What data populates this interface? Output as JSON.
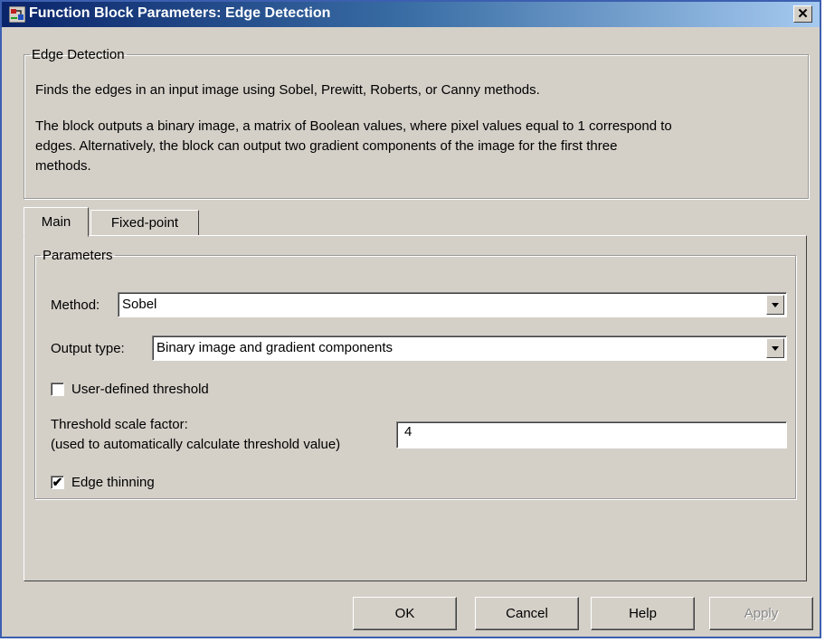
{
  "window": {
    "title": "Function Block Parameters: Edge Detection",
    "close_label": "✕"
  },
  "description": {
    "group_label": "Edge Detection",
    "line1": "Finds the edges in an input image using Sobel, Prewitt, Roberts, or Canny methods.",
    "line2": "The block outputs a binary image, a matrix of Boolean values, where pixel values equal to 1 correspond to",
    "line3": "edges.  Alternatively, the block can output two gradient components of the image for the first three",
    "line4": "methods."
  },
  "tabs": [
    {
      "label": "Main",
      "active": true
    },
    {
      "label": "Fixed-point",
      "active": false
    }
  ],
  "parameters": {
    "group_label": "Parameters",
    "method_label": "Method:",
    "method_value": "Sobel",
    "output_type_label": "Output type:",
    "output_type_value": "Binary image and gradient components",
    "user_threshold_label": "User-defined threshold",
    "user_threshold_checked": false,
    "threshold_scale_label_line1": "Threshold scale factor:",
    "threshold_scale_label_line2": "(used to automatically calculate threshold value)",
    "threshold_scale_value": "4",
    "edge_thinning_label": "Edge thinning",
    "edge_thinning_checked": true,
    "edge_thinning_mark": "✔"
  },
  "buttons": {
    "ok": "OK",
    "cancel": "Cancel",
    "help": "Help",
    "apply": "Apply"
  },
  "colors": {
    "titlebar_start": "#0a246a",
    "titlebar_end": "#a6caf0",
    "dialog_bg": "#d4d0c8"
  }
}
